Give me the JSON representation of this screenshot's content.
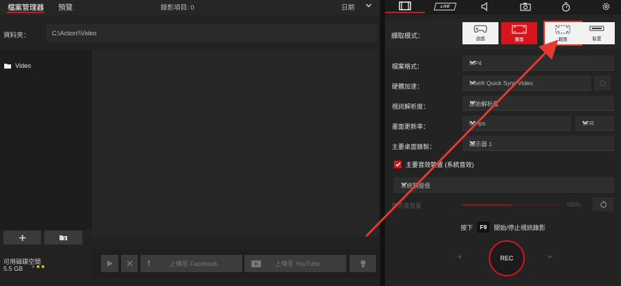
{
  "left": {
    "tabs": [
      {
        "label": "檔案管理器",
        "active": true
      },
      {
        "label": "預覽",
        "active": false
      }
    ],
    "recorded_items_label": "錄影項目: 0",
    "sort_label": "日期",
    "folder": {
      "label": "資料夾：",
      "path": "C:\\Action!\\Video",
      "more": "..."
    },
    "tree": [
      {
        "icon": "folder-icon",
        "label": "Video"
      }
    ],
    "tree_buttons": [
      {
        "icon": "plus-icon"
      },
      {
        "icon": "open-folder-icon"
      }
    ],
    "disk": {
      "label": "可用磁碟空間",
      "size": "5.5 GB"
    },
    "bottom_buttons": [
      {
        "icon": "play-icon",
        "label": ""
      },
      {
        "icon": "close-icon",
        "label": ""
      },
      {
        "icon": "facebook-icon",
        "label": "上傳至 Facebook"
      },
      {
        "icon": "youtube-icon",
        "label": "上傳至 YouTube"
      },
      {
        "icon": "lightbulb-icon",
        "label": ""
      }
    ]
  },
  "right": {
    "tabs": [
      {
        "icon": "film-icon",
        "active": true
      },
      {
        "icon": "live-icon",
        "label": "LIVE",
        "active": false
      },
      {
        "icon": "speaker-icon",
        "active": false
      },
      {
        "icon": "camera-icon",
        "active": false
      },
      {
        "icon": "timer-icon",
        "active": false
      },
      {
        "icon": "gear-icon",
        "active": false
      }
    ],
    "capture_mode": {
      "label": "擷取模式：",
      "modes": [
        {
          "icon": "gamepad-icon",
          "label": "遊戲",
          "state": "normal"
        },
        {
          "icon": "screen-capture-icon",
          "label": "畫面",
          "state": "active"
        },
        {
          "icon": "region-icon",
          "label": "範圍",
          "state": "highlighted"
        },
        {
          "icon": "device-icon",
          "label": "裝置",
          "state": "normal"
        }
      ]
    },
    "settings": [
      {
        "label": "檔案格式：",
        "value": "MP4"
      },
      {
        "label": "硬體加速：",
        "value": "Intel® Quick Sync Video"
      },
      {
        "label": "視訊解析度：",
        "value": "原始解析度"
      },
      {
        "label": "畫面更新率：",
        "value": "60 fps",
        "extra": "VFR"
      },
      {
        "label": "主要桌面錄製：",
        "value": "顯示器 1"
      }
    ],
    "audio": {
      "checkbox_label": "主要音效裝置 (系統音效)",
      "checked": true,
      "device": "系統預設值"
    },
    "volume": {
      "label": "麥克風音量",
      "percent": "100%",
      "level": 0.5
    },
    "hotkey": {
      "prefix": "按下",
      "key": "F9",
      "suffix": "開始/停止視訊錄影"
    },
    "rec_label": "REC",
    "accent": "#d6141d"
  }
}
